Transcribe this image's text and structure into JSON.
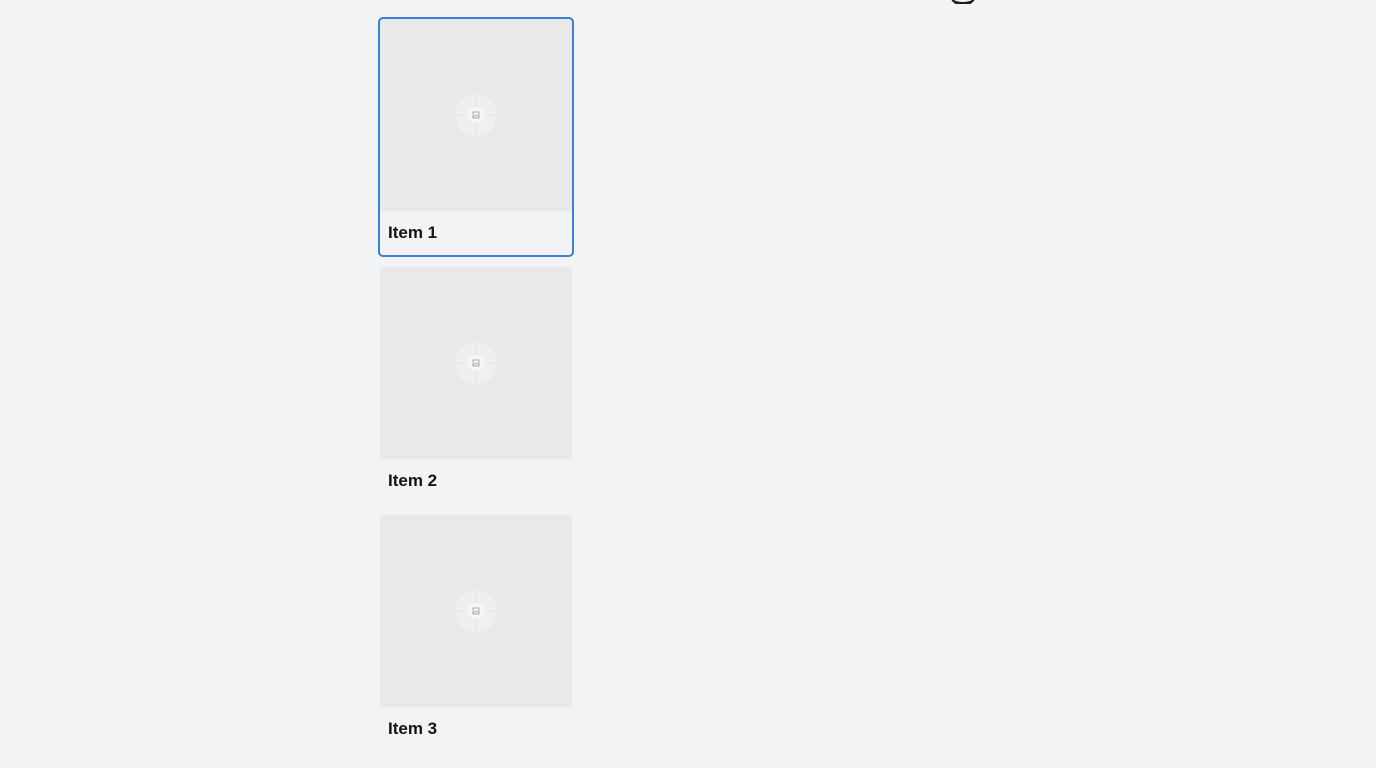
{
  "items": [
    {
      "title": "Item 1",
      "selected": true,
      "thumbnail_icon": "image-placeholder-icon"
    },
    {
      "title": "Item 2",
      "selected": false,
      "thumbnail_icon": "image-placeholder-icon"
    },
    {
      "title": "Item 3",
      "selected": false,
      "thumbnail_icon": "image-placeholder-icon"
    }
  ],
  "colors": {
    "background": "#f2f3f5",
    "thumbnail": "#e9e9ea",
    "selection_border": "#3b7fd6",
    "title_text": "#141414"
  }
}
